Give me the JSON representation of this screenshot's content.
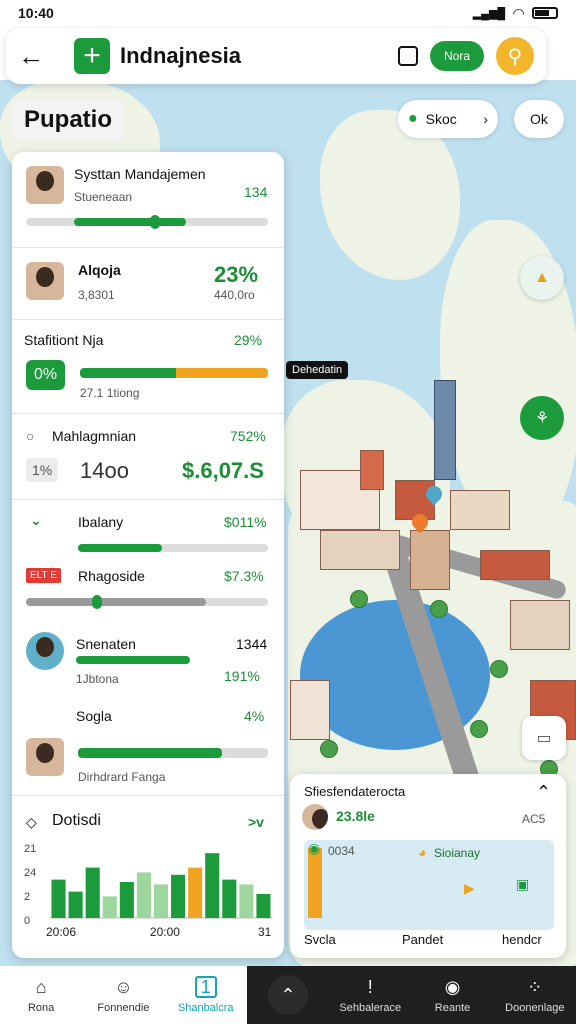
{
  "status_bar": {
    "time": "10:40",
    "signal_left": "▂▄▆█",
    "signal_right": "▂▄▆█"
  },
  "header": {
    "title": "Indnajnesia",
    "pill_label": "Nora"
  },
  "toolbar": {
    "page_title": "Pupatio",
    "scope_label": "Skoc",
    "ok_label": "Ok"
  },
  "map": {
    "callout": "Dehedatin"
  },
  "panel": {
    "row1": {
      "name": "Systtan Mandajemen",
      "sub": "Stueneaan",
      "value": "134",
      "progress": 0.5
    },
    "row2": {
      "name": "Alqoja",
      "sub": "3,8301",
      "value": "23%",
      "sub_value": "440,0ro"
    },
    "row3": {
      "name": "Stafitiont Nja",
      "value": "29%",
      "badge": "0%",
      "sub": "27.1 1tiong",
      "green_fraction": 0.5,
      "orange_fraction": 0.5
    },
    "row4": {
      "name": "Mahlagmnian",
      "value": "752%",
      "badge": "1%",
      "amount": "14oo",
      "total": "$.6,07.S"
    },
    "row5": {
      "name": "Ibalany",
      "value": "$011%",
      "progress": 0.45
    },
    "row6": {
      "tag": "ELT E",
      "name": "Rhagoside",
      "value": "$7.3%",
      "progress": 0.75
    },
    "row7": {
      "name": "Snenaten",
      "value": "1344",
      "sub": "1Jbtona",
      "sub_value": "191%",
      "progress": 0.5
    },
    "row8": {
      "name": "Sogla",
      "value": "4%",
      "sub": "Dirhdrard Fanga",
      "progress": 0.76
    },
    "chart_section": {
      "title": "Dotisdi",
      "expand": ">v"
    }
  },
  "chart_data": {
    "type": "bar",
    "title": "Dotisdi",
    "y_ticks": [
      "21",
      "24",
      "2",
      "0"
    ],
    "x_ticks": [
      "20:06",
      "20:00",
      "31"
    ],
    "ylim": [
      0,
      30
    ],
    "values": [
      16,
      11,
      21,
      9,
      15,
      19,
      14,
      18,
      21,
      27,
      16,
      14,
      10
    ],
    "colors": [
      "#1c9b3c",
      "#1c9b3c",
      "#1c9b3c",
      "#9ed79e",
      "#1c9b3c",
      "#9ed79e",
      "#9ed79e",
      "#1c9b3c",
      "#f0a321",
      "#1c9b3c",
      "#1c9b3c",
      "#9ed79e",
      "#1c9b3c"
    ]
  },
  "float_card": {
    "title": "Sfiesfendaterocta",
    "value": "23.8le",
    "code": "AC5",
    "mini_label_a": "0034",
    "mini_label_b": "Sioianay",
    "footer": [
      "Svcla",
      "Pandet",
      "hendcr"
    ]
  },
  "bottom_nav": [
    {
      "label": "Rona",
      "icon": "home-icon",
      "glyph": "⌂"
    },
    {
      "label": "Fonnendie",
      "icon": "people-icon",
      "glyph": "☺"
    },
    {
      "label": "Shanbalcra",
      "icon": "task-icon",
      "glyph": "1"
    },
    {
      "label": "",
      "icon": "chevron-up-icon",
      "glyph": "⌃"
    },
    {
      "label": "Sehbalerace",
      "icon": "info-icon",
      "glyph": "!"
    },
    {
      "label": "Reante",
      "icon": "record-icon",
      "glyph": "◉"
    },
    {
      "label": "Doonenlage",
      "icon": "dots-icon",
      "glyph": "⁘"
    }
  ]
}
